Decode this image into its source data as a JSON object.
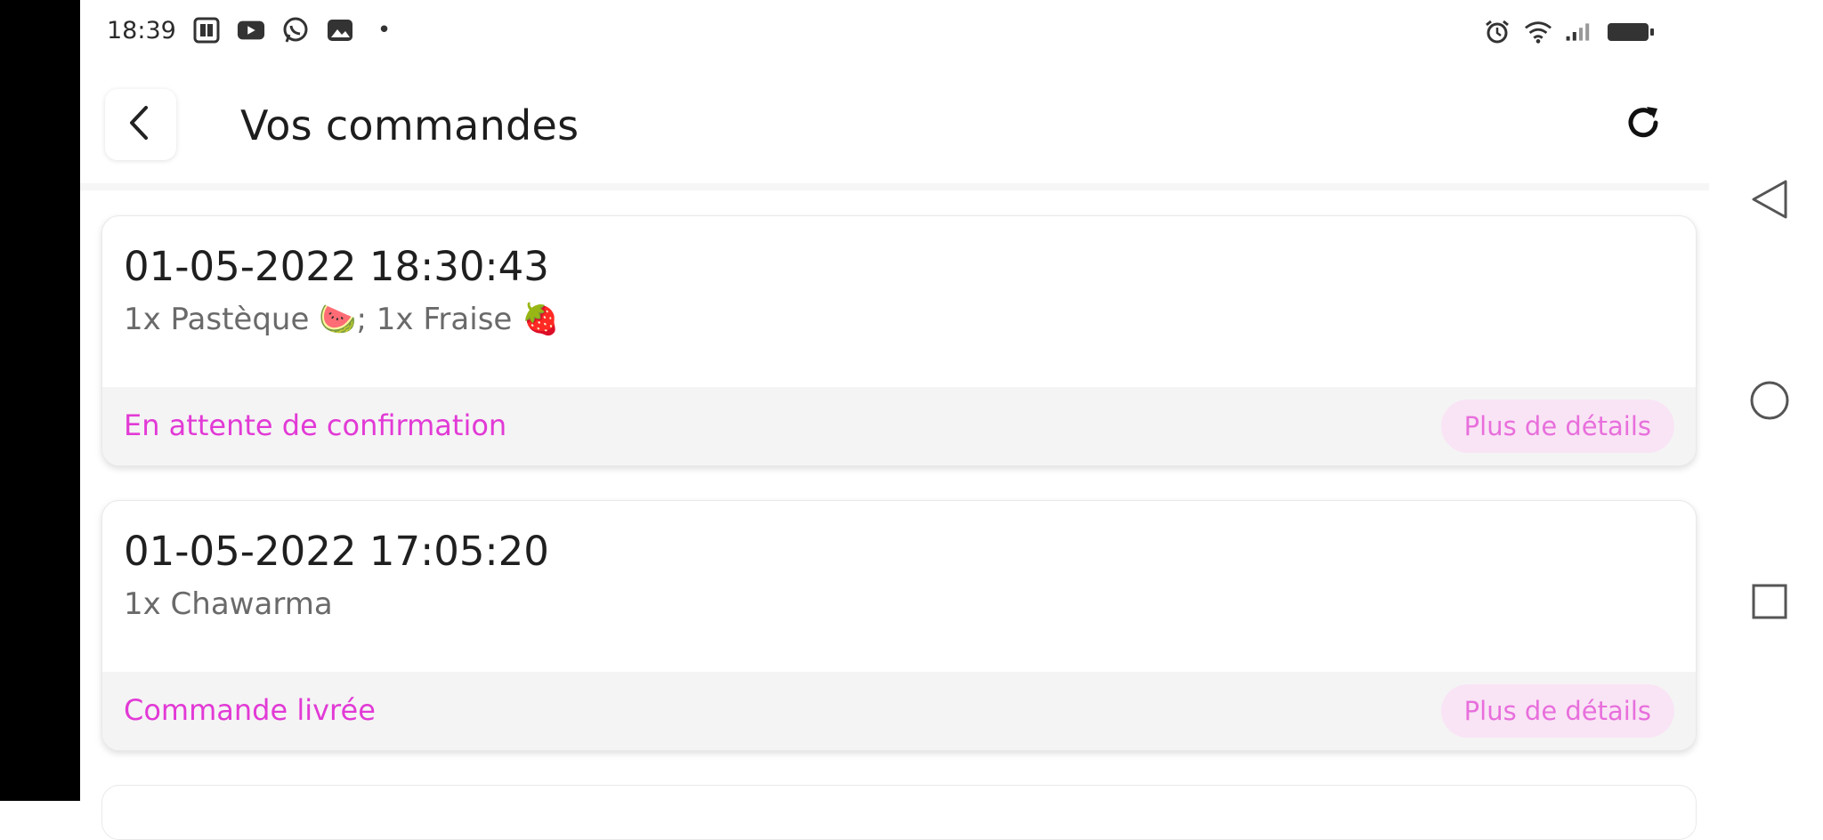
{
  "status_bar": {
    "time": "18:39",
    "left_icons": [
      "gallery-icon",
      "youtube-icon",
      "whatsapp-icon",
      "image-icon"
    ],
    "dot": "•",
    "right_icons": [
      "alarm-icon",
      "wifi-icon",
      "signal-icon",
      "battery-icon"
    ]
  },
  "header": {
    "title": "Vos commandes"
  },
  "orders": [
    {
      "date": "01-05-2022 18:30:43",
      "items": "1x Pastèque 🍉; 1x Fraise 🍓",
      "status": "En attente de confirmation",
      "details_label": "Plus de détails"
    },
    {
      "date": "01-05-2022 17:05:20",
      "items": "1x Chawarma",
      "status": "Commande livrée",
      "details_label": "Plus de détails"
    }
  ],
  "colors": {
    "accent": "#e23ad6",
    "details_bg": "#f9e4f5",
    "footer_bg": "#f4f4f4"
  }
}
